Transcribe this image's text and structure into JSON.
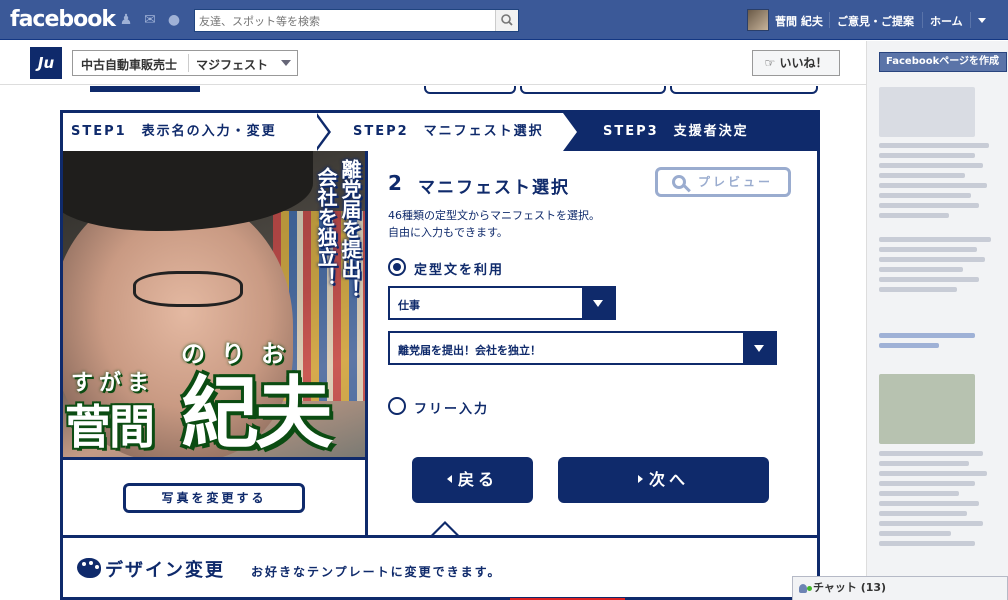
{
  "topbar": {
    "logo": "facebook",
    "search_placeholder": "友達、スポット等を検索",
    "user_name": "菅間 紀夫",
    "feedback": "ご意見・ご提案",
    "home": "ホーム"
  },
  "page_header": {
    "app_icon_text": "Ju",
    "category": "中古自動車販売士",
    "app_name": "マジフェスト",
    "like_label": "いいね！"
  },
  "right_col": {
    "fbpage_label": "Facebookページを作成"
  },
  "steps": [
    {
      "label": "STEP1　表示名の入力・変更"
    },
    {
      "label": "STEP2　マニフェスト選択"
    },
    {
      "label": "STEP3　支援者決定"
    }
  ],
  "poster": {
    "slogan_line1": "離党届を提出！",
    "slogan_line2": "会社を独立！",
    "furigana_family": "すがま",
    "furigana_given": "のりお",
    "name_family": "菅間",
    "name_given": "紀夫",
    "change_photo_label": "写真を変更する"
  },
  "form": {
    "number": "2",
    "title": "マニフェスト選択",
    "preview_label": "プレビュー",
    "desc_line1": "46種類の定型文からマニフェストを選択。",
    "desc_line2": "自由に入力もできます。",
    "option_template_label": "定型文を利用",
    "option_free_label": "フリー入力",
    "category_select_value": "仕事",
    "manifest_select_value": "離党届を提出！会社を独立！",
    "back_label": "戻る",
    "next_label": "次へ"
  },
  "design": {
    "title": "デザイン変更",
    "desc": "お好きなテンプレートに変更できます。"
  },
  "chat": {
    "label": "チャット (13)"
  },
  "colors": {
    "fb_blue": "#3b5998",
    "brand_navy": "#0f2a6b",
    "poster_green": "#0b4c12"
  }
}
